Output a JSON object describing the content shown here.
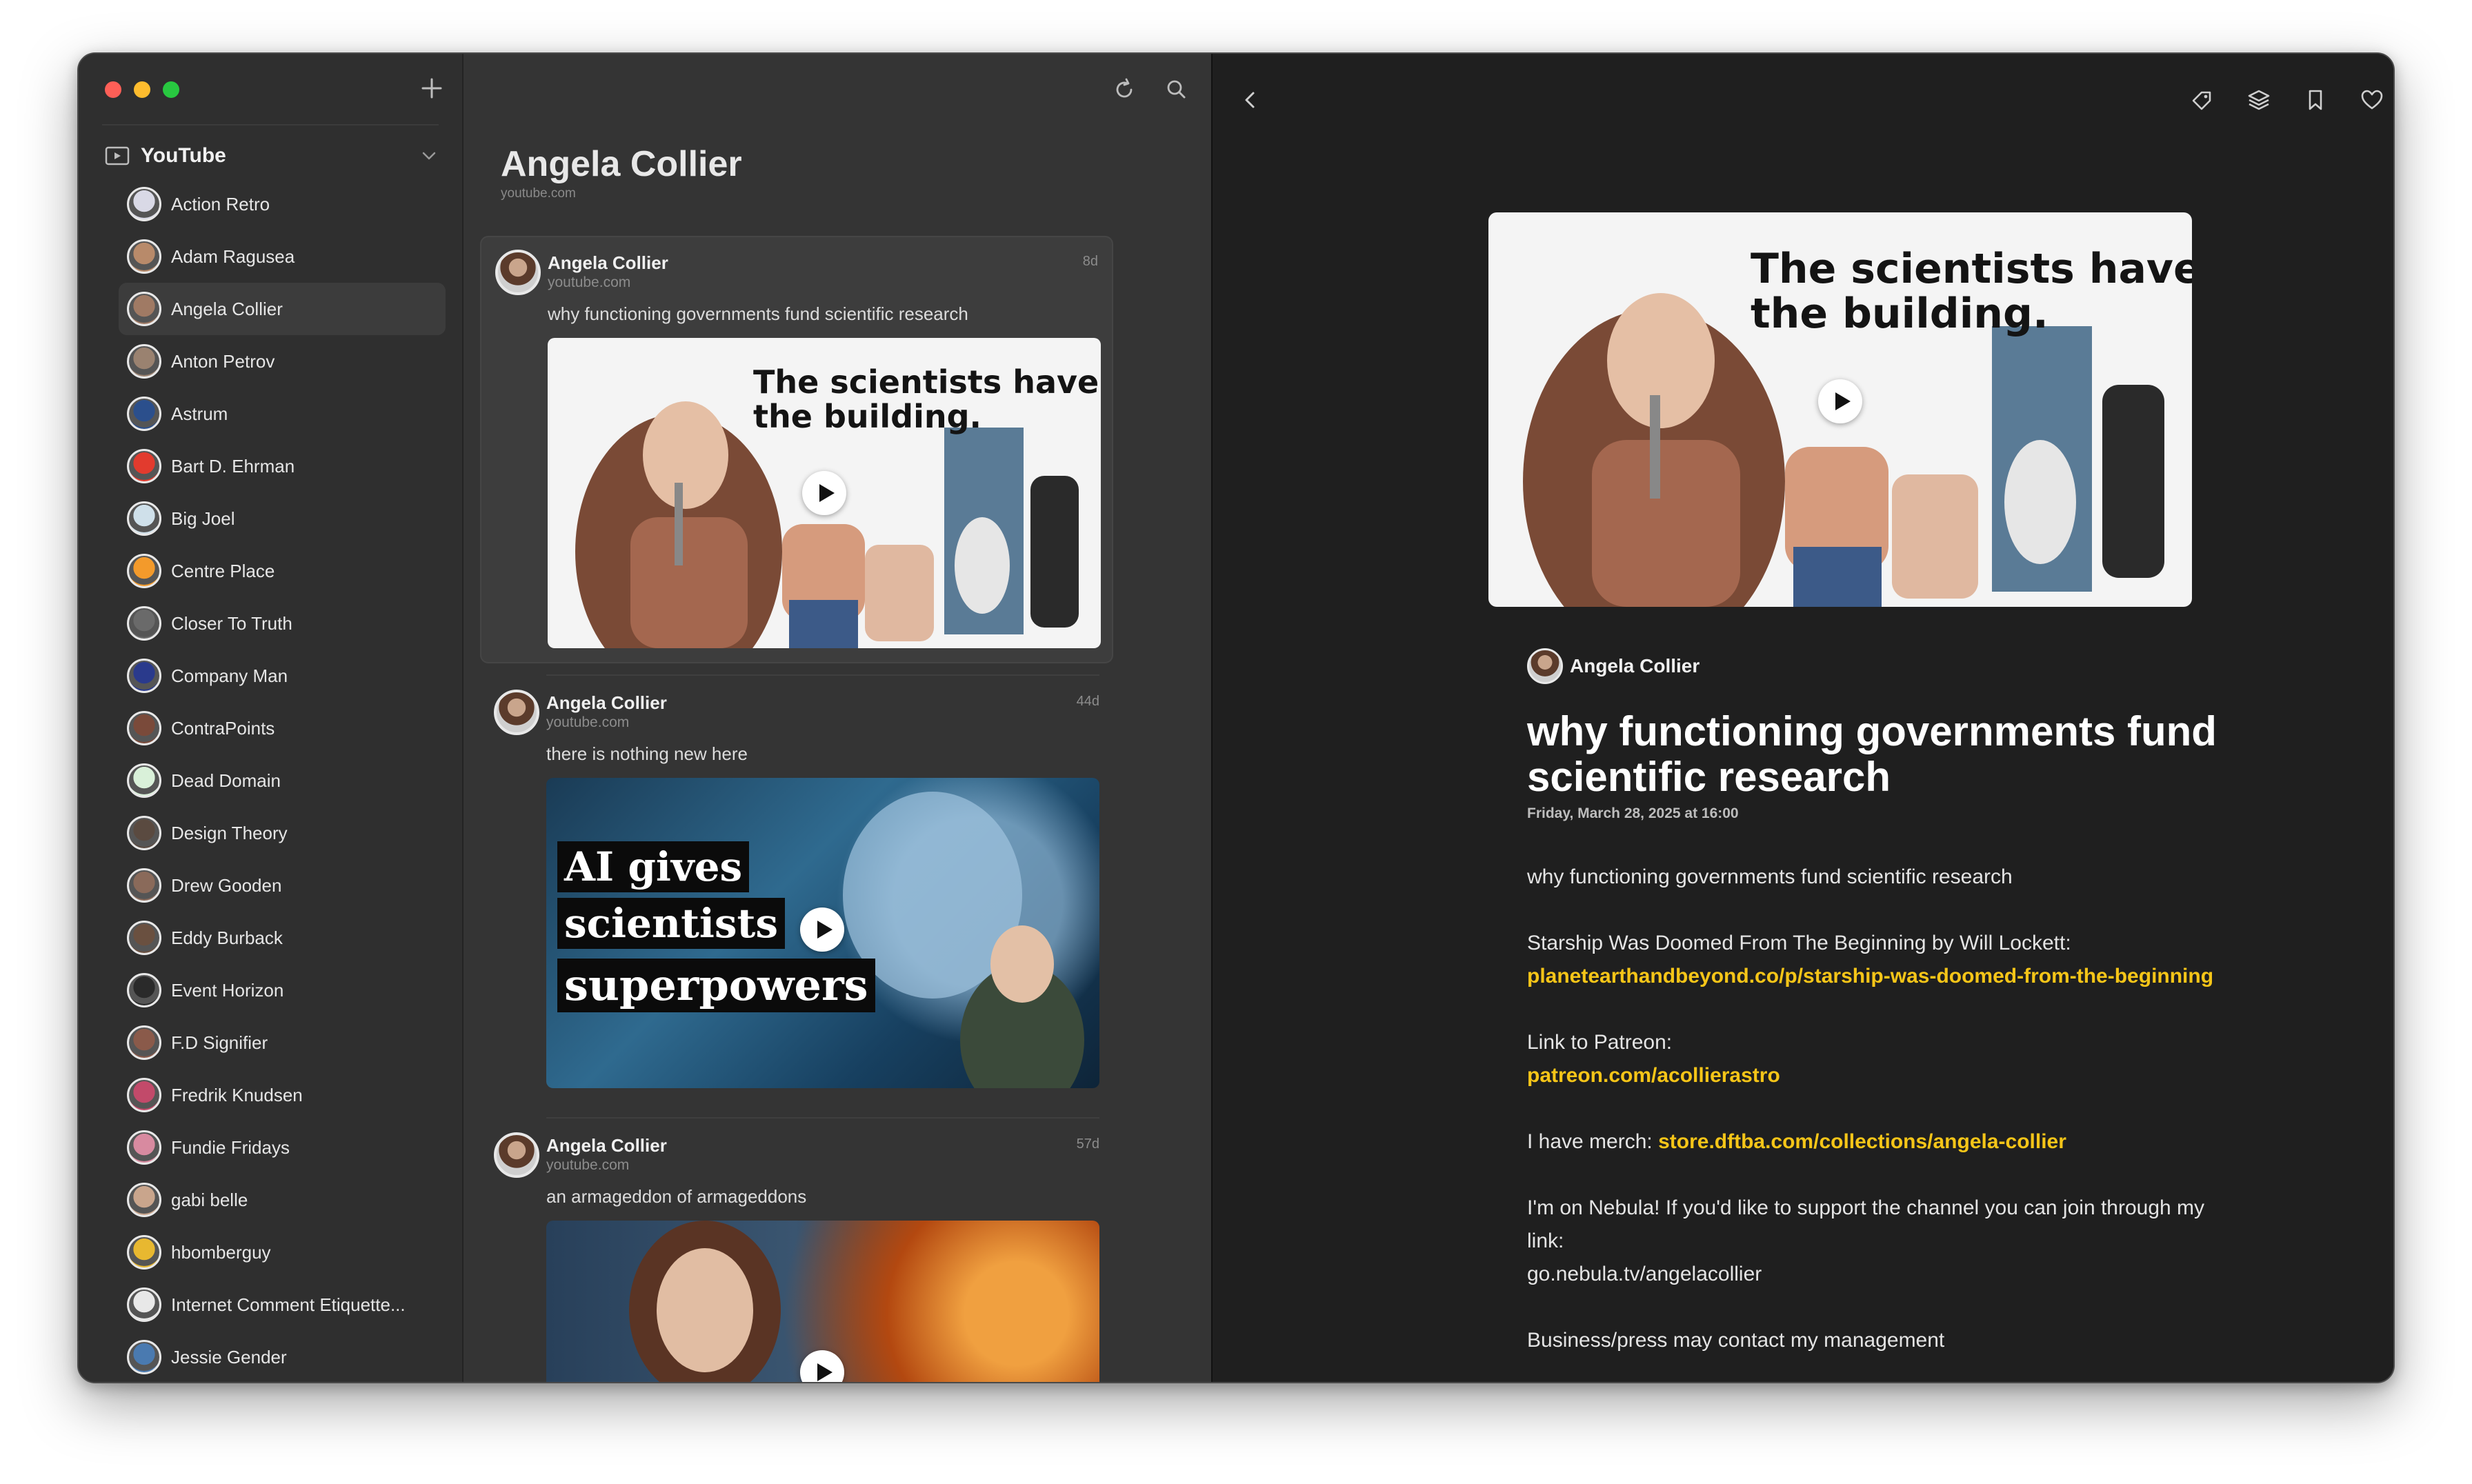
{
  "sidebar": {
    "section_title": "YouTube",
    "feeds": [
      {
        "name": "Action Retro",
        "color": "#d9d9e6"
      },
      {
        "name": "Adam Ragusea",
        "color": "#b88a6a"
      },
      {
        "name": "Angela Collier",
        "color": "#a07a64",
        "selected": true
      },
      {
        "name": "Anton Petrov",
        "color": "#9a8270"
      },
      {
        "name": "Astrum",
        "color": "#2b4f8c"
      },
      {
        "name": "Bart D. Ehrman",
        "color": "#e23b2e"
      },
      {
        "name": "Big Joel",
        "color": "#cfe0ea"
      },
      {
        "name": "Centre Place",
        "color": "#f39a2b"
      },
      {
        "name": "Closer To Truth",
        "color": "#6a6a6a"
      },
      {
        "name": "Company Man",
        "color": "#2a3a8c"
      },
      {
        "name": "ContraPoints",
        "color": "#7a4a3a"
      },
      {
        "name": "Dead Domain",
        "color": "#d9f0d9"
      },
      {
        "name": "Design Theory",
        "color": "#5a4a40"
      },
      {
        "name": "Drew Gooden",
        "color": "#8a6a5a"
      },
      {
        "name": "Eddy Burback",
        "color": "#6a5040"
      },
      {
        "name": "Event Horizon",
        "color": "#2a2a2a"
      },
      {
        "name": "F.D Signifier",
        "color": "#8a5a4a"
      },
      {
        "name": "Fredrik Knudsen",
        "color": "#c24a6a"
      },
      {
        "name": "Fundie Fridays",
        "color": "#d88aa0"
      },
      {
        "name": "gabi belle",
        "color": "#c9a58c"
      },
      {
        "name": "hbomberguy",
        "color": "#e8b830"
      },
      {
        "name": "Internet Comment Etiquette...",
        "color": "#e8e8e8"
      },
      {
        "name": "Jessie Gender",
        "color": "#4a7ab0"
      }
    ]
  },
  "middle": {
    "title": "Angela Collier",
    "subtitle": "youtube.com",
    "articles": [
      {
        "author": "Angela Collier",
        "domain": "youtube.com",
        "age": "8d",
        "title": "why functioning governments fund scientific research",
        "thumb_text": "The scientists have left\nthe building."
      },
      {
        "author": "Angela Collier",
        "domain": "youtube.com",
        "age": "44d",
        "title": "there is nothing new here",
        "thumb_lines": [
          "AI gives",
          "scientists",
          "superpowers"
        ]
      },
      {
        "author": "Angela Collier",
        "domain": "youtube.com",
        "age": "57d",
        "title": "an armageddon of armageddons"
      }
    ]
  },
  "reader": {
    "hero_text": "The scientists have left\nthe building.",
    "author": "Angela Collier",
    "title": "why functioning governments fund scientific research",
    "date": "Friday, March 28, 2025 at 16:00",
    "body": {
      "intro": "why functioning governments fund scientific research",
      "starship_label": "Starship Was Doomed From The Beginning by Will Lockett:",
      "starship_link": "planetearthandbeyond.co/p/starship-was-doomed-from-the-beginning",
      "patreon_label": "Link to Patreon:",
      "patreon_link": "patreon.com/acollierastro",
      "merch_label": "I have merch: ",
      "merch_link": "store.dftba.com/collections/angela-collier",
      "nebula_text": "I'm on Nebula! If you'd like to support the channel you can join through my link:",
      "nebula_link": "go.nebula.tv/angelacollier",
      "business_text": "Business/press may contact my management"
    }
  },
  "colors": {
    "link": "#f5c518",
    "sidebar_bg": "#2f2f2f",
    "list_bg": "#343434",
    "reader_bg": "#1f1f1f"
  }
}
